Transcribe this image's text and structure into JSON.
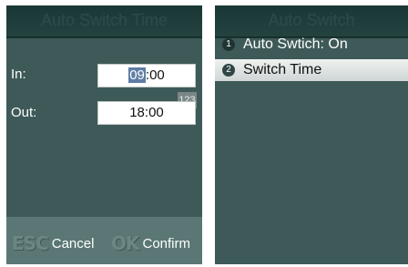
{
  "left_screen": {
    "title": "Auto Switch Time",
    "in_label": "In:",
    "in_hour": "09",
    "in_rest": ":00",
    "out_label": "Out:",
    "out_value": "18:00",
    "input_mode": "123",
    "softkeys": {
      "esc_glyph": "ESC",
      "esc_label": "Cancel",
      "ok_glyph": "OK",
      "ok_label": "Confirm"
    }
  },
  "right_screen": {
    "title": "Auto Switch",
    "items": [
      {
        "number": "1",
        "label": "Auto Swtich: On",
        "selected": false
      },
      {
        "number": "2",
        "label": "Switch Time",
        "selected": true
      }
    ]
  },
  "colors": {
    "screen_bg": "#3e5a58",
    "titlebar_bg": "#1a3735",
    "softkey_bar_bg": "#5b7775",
    "selection_bg": "#dfe5e4",
    "hour_highlight": "#5e7da6"
  },
  "icons": [
    "esc-key-icon",
    "ok-key-icon",
    "number-badge-icon"
  ]
}
